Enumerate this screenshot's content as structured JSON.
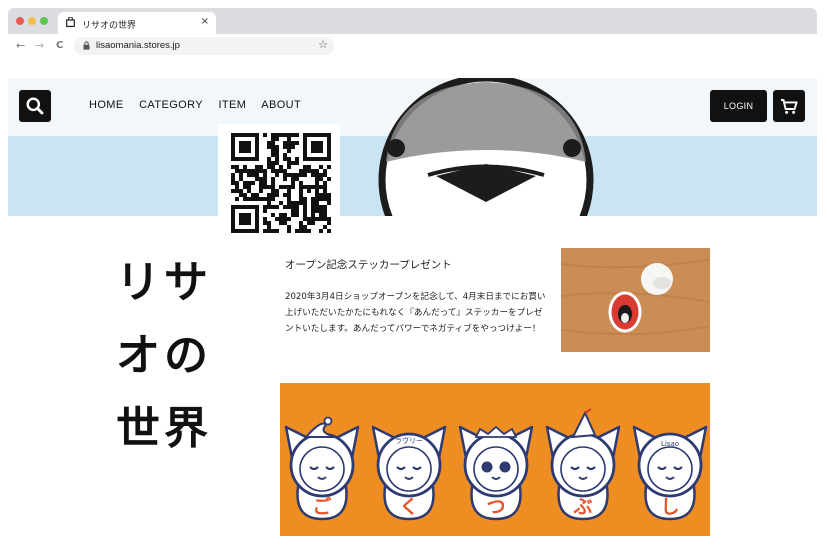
{
  "browser": {
    "tab_title": "リサオの世界",
    "tab_close": "×",
    "url": "lisaomania.stores.jp",
    "back": "←",
    "forward": "→",
    "reload": "C",
    "bookmark": "☆",
    "traffic_light_colors": [
      "#ee5b54",
      "#f4bd4f",
      "#5fc454"
    ]
  },
  "site": {
    "nav": [
      "HOME",
      "CATEGORY",
      "ITEM",
      "ABOUT"
    ],
    "login_label": "LOGIN",
    "shop_title_line1": "リサ",
    "shop_title_line2": "オの",
    "shop_title_line3": "世界",
    "hero_colors": {
      "top": "#f1f7fb",
      "band": "#c9e4f2"
    },
    "banner_color": "#ee8e22"
  },
  "post": {
    "title": "オープン記念ステッカープレゼント",
    "body": "2020年3月4日ショップオープンを記念して、4月末日までにお買い上げいただいたかたにもれなく『あんだって』ステッカーをプレゼントいたします。あんだってパワーでネガティブをやっつけよー！"
  },
  "banner": {
    "characters": [
      "ご",
      "く",
      "つ",
      "ぶ",
      "し"
    ],
    "headwear_labels": [
      "",
      "ラヴリー",
      "",
      "",
      "Lisao"
    ]
  }
}
